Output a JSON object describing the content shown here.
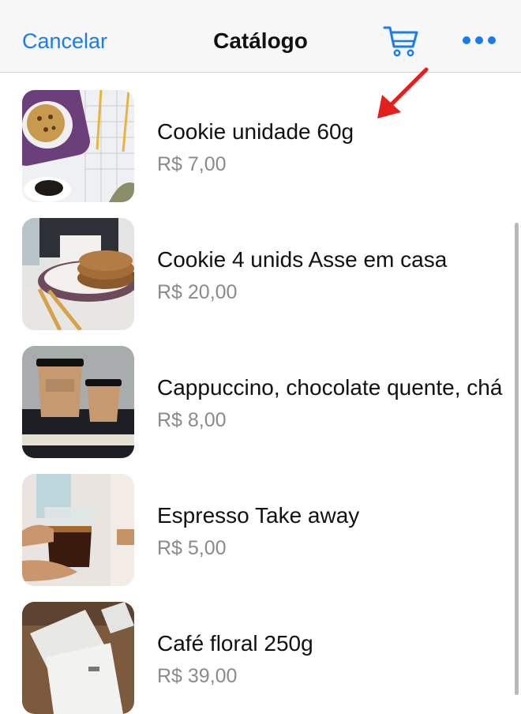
{
  "navbar": {
    "cancel_label": "Cancelar",
    "title": "Catálogo",
    "cart_icon": "cart-icon",
    "more_icon": "more-icon"
  },
  "items": [
    {
      "name": "Cookie unidade 60g",
      "price": "R$ 7,00"
    },
    {
      "name": "Cookie 4 unids Asse em casa",
      "price": "R$ 20,00"
    },
    {
      "name": "Cappuccino, chocolate quente, chá",
      "price": "R$ 8,00"
    },
    {
      "name": "Espresso Take away",
      "price": "R$ 5,00"
    },
    {
      "name": "Café floral 250g",
      "price": "R$ 39,00"
    }
  ],
  "colors": {
    "accent": "#1a7cf0",
    "annotation_arrow": "#e3201b",
    "price_text": "#8a8a8e"
  }
}
